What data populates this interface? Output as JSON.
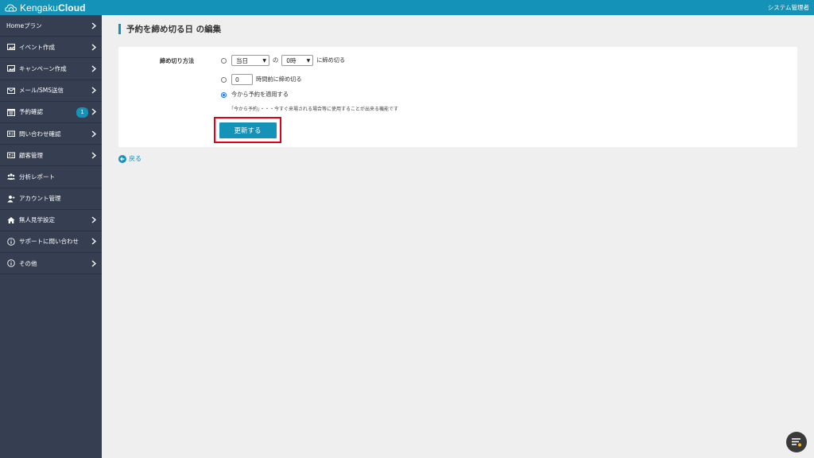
{
  "header": {
    "logo_prefix": "Kengaku",
    "logo_suffix": "Cloud",
    "user_name": "システム管理者"
  },
  "sidebar": {
    "items": [
      {
        "label": "Homeプラン",
        "icon": "none",
        "has_chevron": true
      },
      {
        "label": "イベント作成",
        "icon": "image-icon",
        "has_chevron": true
      },
      {
        "label": "キャンペーン作成",
        "icon": "image-icon",
        "has_chevron": true
      },
      {
        "label": "メール/SMS送信",
        "icon": "mail-icon",
        "has_chevron": true
      },
      {
        "label": "予約確認",
        "icon": "calendar-icon",
        "has_chevron": true,
        "badge": "1"
      },
      {
        "label": "問い合わせ確認",
        "icon": "id-card-icon",
        "has_chevron": true
      },
      {
        "label": "顧客管理",
        "icon": "id-card-icon",
        "has_chevron": true
      },
      {
        "label": "分析レポート",
        "icon": "users-icon",
        "has_chevron": false
      },
      {
        "label": "アカウント管理",
        "icon": "user-plus-icon",
        "has_chevron": false
      },
      {
        "label": "無人見学設定",
        "icon": "home-icon",
        "has_chevron": true
      },
      {
        "label": "サポートに問い合わせ",
        "icon": "info-icon",
        "has_chevron": true
      },
      {
        "label": "その他",
        "icon": "info-icon",
        "has_chevron": true
      }
    ]
  },
  "main": {
    "page_title": "予約を締め切る日 の編集",
    "field_label": "締め切り方法",
    "option1": {
      "day_select": "当日",
      "connector": "の",
      "hour_select": "0時",
      "suffix": "に締め切る"
    },
    "option2": {
      "hours_value": "0",
      "suffix": "時間前に締め切る"
    },
    "option3": {
      "label": "今から予約を適用する",
      "note": "「今から予約」・・・今すぐ来場される場合等に使用することが出来る機能です"
    },
    "selected_option": 3,
    "update_button": "更新する",
    "back_link": "戻る"
  },
  "colors": {
    "accent": "#1592b8",
    "sidebar_bg": "#363f52",
    "highlight_border": "#e0001a"
  }
}
